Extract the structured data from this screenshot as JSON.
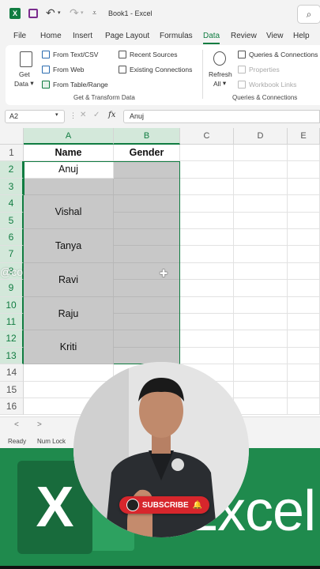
{
  "titlebar": {
    "app_icon_letter": "X",
    "title": "Book1 - Excel",
    "undo_glyph": "↶",
    "redo_glyph": "↷",
    "more_glyph": "⩡",
    "search_glyph": "⌕"
  },
  "tabs": [
    {
      "label": "File"
    },
    {
      "label": "Home"
    },
    {
      "label": "Insert"
    },
    {
      "label": "Page Layout"
    },
    {
      "label": "Formulas"
    },
    {
      "label": "Data",
      "active": true
    },
    {
      "label": "Review"
    },
    {
      "label": "View"
    },
    {
      "label": "Help"
    }
  ],
  "ribbon": {
    "get_data_line1": "Get",
    "get_data_line2": "Data",
    "from_text_csv": "From Text/CSV",
    "from_web": "From Web",
    "from_table_range": "From Table/Range",
    "recent_sources": "Recent Sources",
    "existing_connections": "Existing Connections",
    "group_get_transform": "Get & Transform Data",
    "refresh_line1": "Refresh",
    "refresh_line2": "All",
    "queries_connections": "Queries & Connections",
    "properties": "Properties",
    "workbook_links": "Workbook Links",
    "group_queries": "Queries & Connections"
  },
  "formula_bar": {
    "name_box": "A2",
    "dots": "⋮",
    "cancel": "✕",
    "enter": "✓",
    "fx": "fx",
    "value": "Anuj"
  },
  "columns": [
    "A",
    "B",
    "C",
    "D",
    "E"
  ],
  "rows": [
    "1",
    "2",
    "3",
    "4",
    "5",
    "6",
    "7",
    "8",
    "9",
    "10",
    "11",
    "12",
    "13",
    "14",
    "15",
    "16"
  ],
  "headers": {
    "name": "Name",
    "gender": "Gender"
  },
  "names": [
    "Anuj",
    "",
    "Vishal",
    "",
    "Tanya",
    "",
    "Ravi",
    "",
    "Raju",
    "",
    "Kriti",
    ""
  ],
  "watermark": "@collagevision",
  "sheetbar": {
    "prev": "<",
    "next": ">"
  },
  "status": {
    "ready": "Ready",
    "num_lock": "Num Lock"
  },
  "banner": {
    "x_letter": "X",
    "word": "Excel"
  },
  "subscribe": {
    "label": "SUBSCRIBE",
    "bell": "🔔"
  },
  "colors": {
    "excel_green": "#107c41",
    "selection_fill": "#c8c8c8",
    "banner_green": "#1f8a4d",
    "subscribe_red": "#d7262c"
  }
}
